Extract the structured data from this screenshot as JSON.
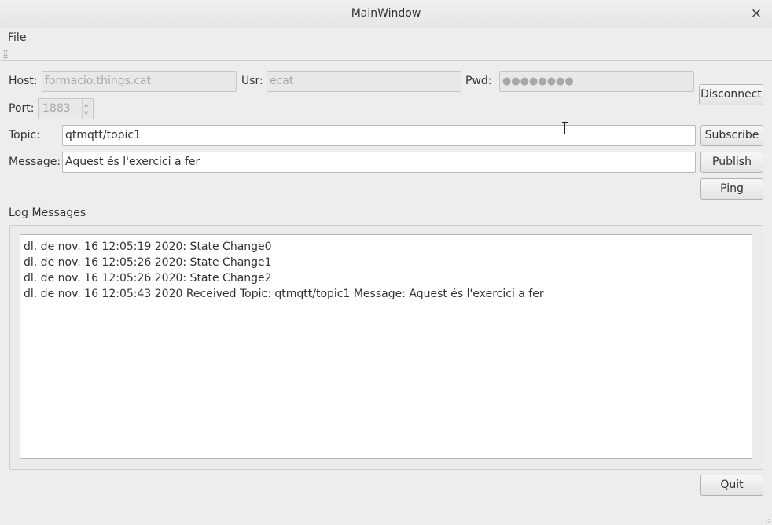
{
  "window": {
    "title": "MainWindow",
    "close_glyph": "×"
  },
  "menubar": {
    "items": [
      {
        "label": "File"
      }
    ]
  },
  "connection": {
    "host_label": "Host:",
    "host_value": "formacio.things.cat",
    "user_label": "Usr:",
    "user_value": "ecat",
    "pwd_label": "Pwd:",
    "pwd_value": "●●●●●●●●",
    "port_label": "Port:",
    "port_value": "1883",
    "disconnect_label": "Disconnect"
  },
  "topic": {
    "label": "Topic:",
    "value": "qtmqtt/topic1",
    "subscribe_label": "Subscribe"
  },
  "message": {
    "label": "Message:",
    "value": "Aquest és l'exercici a fer",
    "publish_label": "Publish"
  },
  "ping_label": "Ping",
  "log": {
    "title": "Log Messages",
    "lines": [
      "dl. de nov. 16 12:05:19 2020: State Change0",
      "dl. de nov. 16 12:05:26 2020: State Change1",
      "dl. de nov. 16 12:05:26 2020: State Change2",
      "dl. de nov. 16 12:05:43 2020 Received Topic: qtmqtt/topic1 Message: Aquest és l'exercici a fer"
    ]
  },
  "quit_label": "Quit",
  "icons": {
    "close": "close-icon",
    "cursor": "text-cursor-icon",
    "toolbar_grip": "grip-icon",
    "spin_up": "chevron-up-icon",
    "spin_down": "chevron-down-icon"
  }
}
